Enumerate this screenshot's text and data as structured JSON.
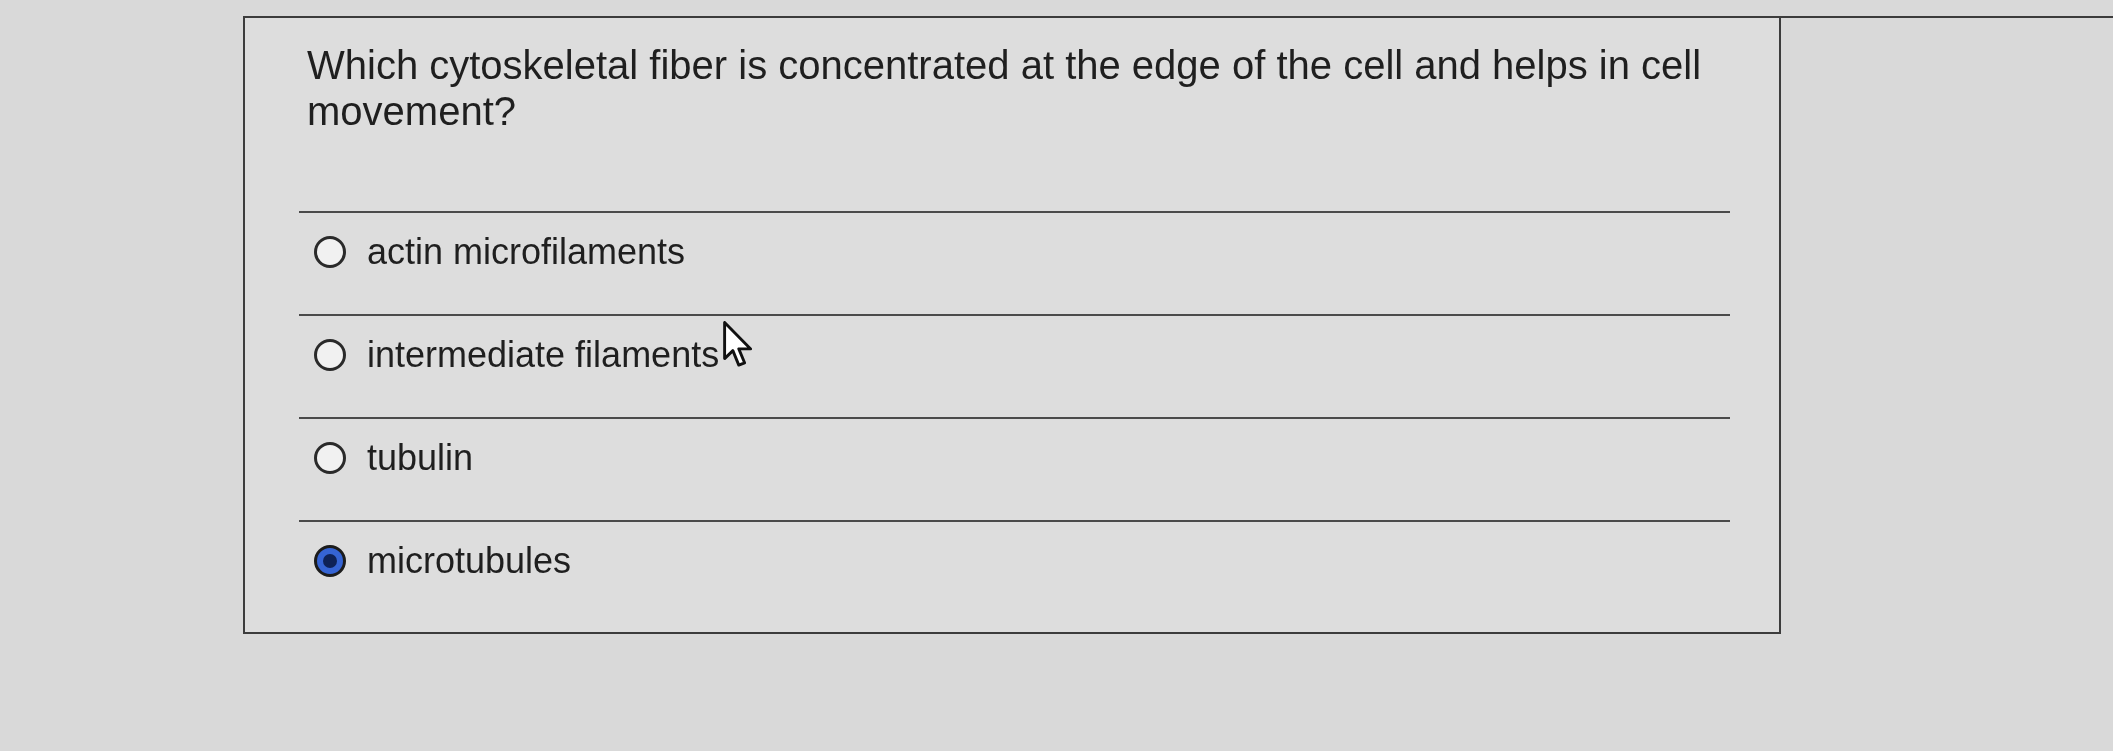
{
  "question": {
    "text": "Which cytoskeletal fiber is concentrated at the edge of the cell and helps in cell movement?"
  },
  "options": [
    {
      "label": "actin microfilaments",
      "selected": false,
      "hovered": false
    },
    {
      "label": "intermediate filaments",
      "selected": false,
      "hovered": true
    },
    {
      "label": "tubulin",
      "selected": false,
      "hovered": false
    },
    {
      "label": "microtubules",
      "selected": true,
      "hovered": false
    }
  ]
}
